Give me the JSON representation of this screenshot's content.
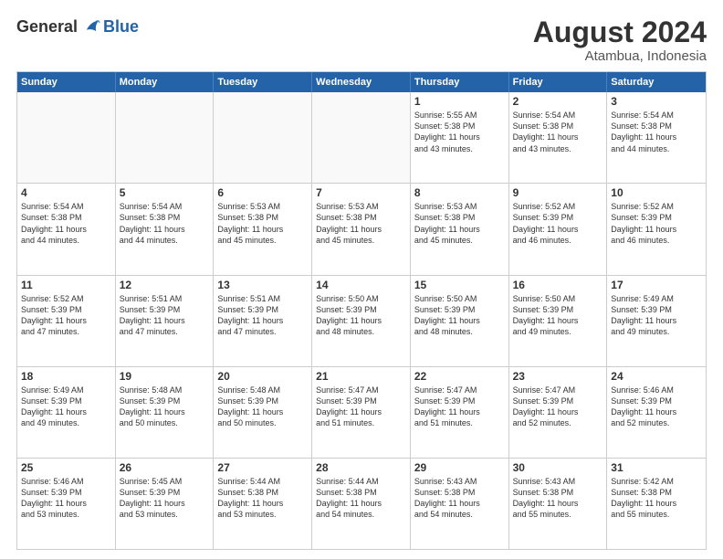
{
  "logo": {
    "general": "General",
    "blue": "Blue"
  },
  "title": "August 2024",
  "location": "Atambua, Indonesia",
  "days": [
    "Sunday",
    "Monday",
    "Tuesday",
    "Wednesday",
    "Thursday",
    "Friday",
    "Saturday"
  ],
  "weeks": [
    [
      {
        "day": "",
        "info": ""
      },
      {
        "day": "",
        "info": ""
      },
      {
        "day": "",
        "info": ""
      },
      {
        "day": "",
        "info": ""
      },
      {
        "day": "1",
        "info": "Sunrise: 5:55 AM\nSunset: 5:38 PM\nDaylight: 11 hours\nand 43 minutes."
      },
      {
        "day": "2",
        "info": "Sunrise: 5:54 AM\nSunset: 5:38 PM\nDaylight: 11 hours\nand 43 minutes."
      },
      {
        "day": "3",
        "info": "Sunrise: 5:54 AM\nSunset: 5:38 PM\nDaylight: 11 hours\nand 44 minutes."
      }
    ],
    [
      {
        "day": "4",
        "info": "Sunrise: 5:54 AM\nSunset: 5:38 PM\nDaylight: 11 hours\nand 44 minutes."
      },
      {
        "day": "5",
        "info": "Sunrise: 5:54 AM\nSunset: 5:38 PM\nDaylight: 11 hours\nand 44 minutes."
      },
      {
        "day": "6",
        "info": "Sunrise: 5:53 AM\nSunset: 5:38 PM\nDaylight: 11 hours\nand 45 minutes."
      },
      {
        "day": "7",
        "info": "Sunrise: 5:53 AM\nSunset: 5:38 PM\nDaylight: 11 hours\nand 45 minutes."
      },
      {
        "day": "8",
        "info": "Sunrise: 5:53 AM\nSunset: 5:38 PM\nDaylight: 11 hours\nand 45 minutes."
      },
      {
        "day": "9",
        "info": "Sunrise: 5:52 AM\nSunset: 5:39 PM\nDaylight: 11 hours\nand 46 minutes."
      },
      {
        "day": "10",
        "info": "Sunrise: 5:52 AM\nSunset: 5:39 PM\nDaylight: 11 hours\nand 46 minutes."
      }
    ],
    [
      {
        "day": "11",
        "info": "Sunrise: 5:52 AM\nSunset: 5:39 PM\nDaylight: 11 hours\nand 47 minutes."
      },
      {
        "day": "12",
        "info": "Sunrise: 5:51 AM\nSunset: 5:39 PM\nDaylight: 11 hours\nand 47 minutes."
      },
      {
        "day": "13",
        "info": "Sunrise: 5:51 AM\nSunset: 5:39 PM\nDaylight: 11 hours\nand 47 minutes."
      },
      {
        "day": "14",
        "info": "Sunrise: 5:50 AM\nSunset: 5:39 PM\nDaylight: 11 hours\nand 48 minutes."
      },
      {
        "day": "15",
        "info": "Sunrise: 5:50 AM\nSunset: 5:39 PM\nDaylight: 11 hours\nand 48 minutes."
      },
      {
        "day": "16",
        "info": "Sunrise: 5:50 AM\nSunset: 5:39 PM\nDaylight: 11 hours\nand 49 minutes."
      },
      {
        "day": "17",
        "info": "Sunrise: 5:49 AM\nSunset: 5:39 PM\nDaylight: 11 hours\nand 49 minutes."
      }
    ],
    [
      {
        "day": "18",
        "info": "Sunrise: 5:49 AM\nSunset: 5:39 PM\nDaylight: 11 hours\nand 49 minutes."
      },
      {
        "day": "19",
        "info": "Sunrise: 5:48 AM\nSunset: 5:39 PM\nDaylight: 11 hours\nand 50 minutes."
      },
      {
        "day": "20",
        "info": "Sunrise: 5:48 AM\nSunset: 5:39 PM\nDaylight: 11 hours\nand 50 minutes."
      },
      {
        "day": "21",
        "info": "Sunrise: 5:47 AM\nSunset: 5:39 PM\nDaylight: 11 hours\nand 51 minutes."
      },
      {
        "day": "22",
        "info": "Sunrise: 5:47 AM\nSunset: 5:39 PM\nDaylight: 11 hours\nand 51 minutes."
      },
      {
        "day": "23",
        "info": "Sunrise: 5:47 AM\nSunset: 5:39 PM\nDaylight: 11 hours\nand 52 minutes."
      },
      {
        "day": "24",
        "info": "Sunrise: 5:46 AM\nSunset: 5:39 PM\nDaylight: 11 hours\nand 52 minutes."
      }
    ],
    [
      {
        "day": "25",
        "info": "Sunrise: 5:46 AM\nSunset: 5:39 PM\nDaylight: 11 hours\nand 53 minutes."
      },
      {
        "day": "26",
        "info": "Sunrise: 5:45 AM\nSunset: 5:39 PM\nDaylight: 11 hours\nand 53 minutes."
      },
      {
        "day": "27",
        "info": "Sunrise: 5:44 AM\nSunset: 5:38 PM\nDaylight: 11 hours\nand 53 minutes."
      },
      {
        "day": "28",
        "info": "Sunrise: 5:44 AM\nSunset: 5:38 PM\nDaylight: 11 hours\nand 54 minutes."
      },
      {
        "day": "29",
        "info": "Sunrise: 5:43 AM\nSunset: 5:38 PM\nDaylight: 11 hours\nand 54 minutes."
      },
      {
        "day": "30",
        "info": "Sunrise: 5:43 AM\nSunset: 5:38 PM\nDaylight: 11 hours\nand 55 minutes."
      },
      {
        "day": "31",
        "info": "Sunrise: 5:42 AM\nSunset: 5:38 PM\nDaylight: 11 hours\nand 55 minutes."
      }
    ]
  ]
}
